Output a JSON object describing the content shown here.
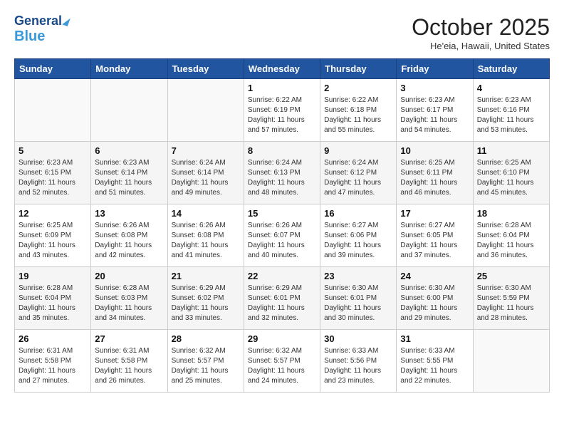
{
  "header": {
    "logo_line1": "General",
    "logo_line2": "Blue",
    "month_title": "October 2025",
    "location": "He'eia, Hawaii, United States"
  },
  "days_of_week": [
    "Sunday",
    "Monday",
    "Tuesday",
    "Wednesday",
    "Thursday",
    "Friday",
    "Saturday"
  ],
  "weeks": [
    [
      {
        "day": "",
        "sunrise": "",
        "sunset": "",
        "daylight": ""
      },
      {
        "day": "",
        "sunrise": "",
        "sunset": "",
        "daylight": ""
      },
      {
        "day": "",
        "sunrise": "",
        "sunset": "",
        "daylight": ""
      },
      {
        "day": "1",
        "sunrise": "Sunrise: 6:22 AM",
        "sunset": "Sunset: 6:19 PM",
        "daylight": "Daylight: 11 hours and 57 minutes."
      },
      {
        "day": "2",
        "sunrise": "Sunrise: 6:22 AM",
        "sunset": "Sunset: 6:18 PM",
        "daylight": "Daylight: 11 hours and 55 minutes."
      },
      {
        "day": "3",
        "sunrise": "Sunrise: 6:23 AM",
        "sunset": "Sunset: 6:17 PM",
        "daylight": "Daylight: 11 hours and 54 minutes."
      },
      {
        "day": "4",
        "sunrise": "Sunrise: 6:23 AM",
        "sunset": "Sunset: 6:16 PM",
        "daylight": "Daylight: 11 hours and 53 minutes."
      }
    ],
    [
      {
        "day": "5",
        "sunrise": "Sunrise: 6:23 AM",
        "sunset": "Sunset: 6:15 PM",
        "daylight": "Daylight: 11 hours and 52 minutes."
      },
      {
        "day": "6",
        "sunrise": "Sunrise: 6:23 AM",
        "sunset": "Sunset: 6:14 PM",
        "daylight": "Daylight: 11 hours and 51 minutes."
      },
      {
        "day": "7",
        "sunrise": "Sunrise: 6:24 AM",
        "sunset": "Sunset: 6:14 PM",
        "daylight": "Daylight: 11 hours and 49 minutes."
      },
      {
        "day": "8",
        "sunrise": "Sunrise: 6:24 AM",
        "sunset": "Sunset: 6:13 PM",
        "daylight": "Daylight: 11 hours and 48 minutes."
      },
      {
        "day": "9",
        "sunrise": "Sunrise: 6:24 AM",
        "sunset": "Sunset: 6:12 PM",
        "daylight": "Daylight: 11 hours and 47 minutes."
      },
      {
        "day": "10",
        "sunrise": "Sunrise: 6:25 AM",
        "sunset": "Sunset: 6:11 PM",
        "daylight": "Daylight: 11 hours and 46 minutes."
      },
      {
        "day": "11",
        "sunrise": "Sunrise: 6:25 AM",
        "sunset": "Sunset: 6:10 PM",
        "daylight": "Daylight: 11 hours and 45 minutes."
      }
    ],
    [
      {
        "day": "12",
        "sunrise": "Sunrise: 6:25 AM",
        "sunset": "Sunset: 6:09 PM",
        "daylight": "Daylight: 11 hours and 43 minutes."
      },
      {
        "day": "13",
        "sunrise": "Sunrise: 6:26 AM",
        "sunset": "Sunset: 6:08 PM",
        "daylight": "Daylight: 11 hours and 42 minutes."
      },
      {
        "day": "14",
        "sunrise": "Sunrise: 6:26 AM",
        "sunset": "Sunset: 6:08 PM",
        "daylight": "Daylight: 11 hours and 41 minutes."
      },
      {
        "day": "15",
        "sunrise": "Sunrise: 6:26 AM",
        "sunset": "Sunset: 6:07 PM",
        "daylight": "Daylight: 11 hours and 40 minutes."
      },
      {
        "day": "16",
        "sunrise": "Sunrise: 6:27 AM",
        "sunset": "Sunset: 6:06 PM",
        "daylight": "Daylight: 11 hours and 39 minutes."
      },
      {
        "day": "17",
        "sunrise": "Sunrise: 6:27 AM",
        "sunset": "Sunset: 6:05 PM",
        "daylight": "Daylight: 11 hours and 37 minutes."
      },
      {
        "day": "18",
        "sunrise": "Sunrise: 6:28 AM",
        "sunset": "Sunset: 6:04 PM",
        "daylight": "Daylight: 11 hours and 36 minutes."
      }
    ],
    [
      {
        "day": "19",
        "sunrise": "Sunrise: 6:28 AM",
        "sunset": "Sunset: 6:04 PM",
        "daylight": "Daylight: 11 hours and 35 minutes."
      },
      {
        "day": "20",
        "sunrise": "Sunrise: 6:28 AM",
        "sunset": "Sunset: 6:03 PM",
        "daylight": "Daylight: 11 hours and 34 minutes."
      },
      {
        "day": "21",
        "sunrise": "Sunrise: 6:29 AM",
        "sunset": "Sunset: 6:02 PM",
        "daylight": "Daylight: 11 hours and 33 minutes."
      },
      {
        "day": "22",
        "sunrise": "Sunrise: 6:29 AM",
        "sunset": "Sunset: 6:01 PM",
        "daylight": "Daylight: 11 hours and 32 minutes."
      },
      {
        "day": "23",
        "sunrise": "Sunrise: 6:30 AM",
        "sunset": "Sunset: 6:01 PM",
        "daylight": "Daylight: 11 hours and 30 minutes."
      },
      {
        "day": "24",
        "sunrise": "Sunrise: 6:30 AM",
        "sunset": "Sunset: 6:00 PM",
        "daylight": "Daylight: 11 hours and 29 minutes."
      },
      {
        "day": "25",
        "sunrise": "Sunrise: 6:30 AM",
        "sunset": "Sunset: 5:59 PM",
        "daylight": "Daylight: 11 hours and 28 minutes."
      }
    ],
    [
      {
        "day": "26",
        "sunrise": "Sunrise: 6:31 AM",
        "sunset": "Sunset: 5:58 PM",
        "daylight": "Daylight: 11 hours and 27 minutes."
      },
      {
        "day": "27",
        "sunrise": "Sunrise: 6:31 AM",
        "sunset": "Sunset: 5:58 PM",
        "daylight": "Daylight: 11 hours and 26 minutes."
      },
      {
        "day": "28",
        "sunrise": "Sunrise: 6:32 AM",
        "sunset": "Sunset: 5:57 PM",
        "daylight": "Daylight: 11 hours and 25 minutes."
      },
      {
        "day": "29",
        "sunrise": "Sunrise: 6:32 AM",
        "sunset": "Sunset: 5:57 PM",
        "daylight": "Daylight: 11 hours and 24 minutes."
      },
      {
        "day": "30",
        "sunrise": "Sunrise: 6:33 AM",
        "sunset": "Sunset: 5:56 PM",
        "daylight": "Daylight: 11 hours and 23 minutes."
      },
      {
        "day": "31",
        "sunrise": "Sunrise: 6:33 AM",
        "sunset": "Sunset: 5:55 PM",
        "daylight": "Daylight: 11 hours and 22 minutes."
      },
      {
        "day": "",
        "sunrise": "",
        "sunset": "",
        "daylight": ""
      }
    ]
  ]
}
